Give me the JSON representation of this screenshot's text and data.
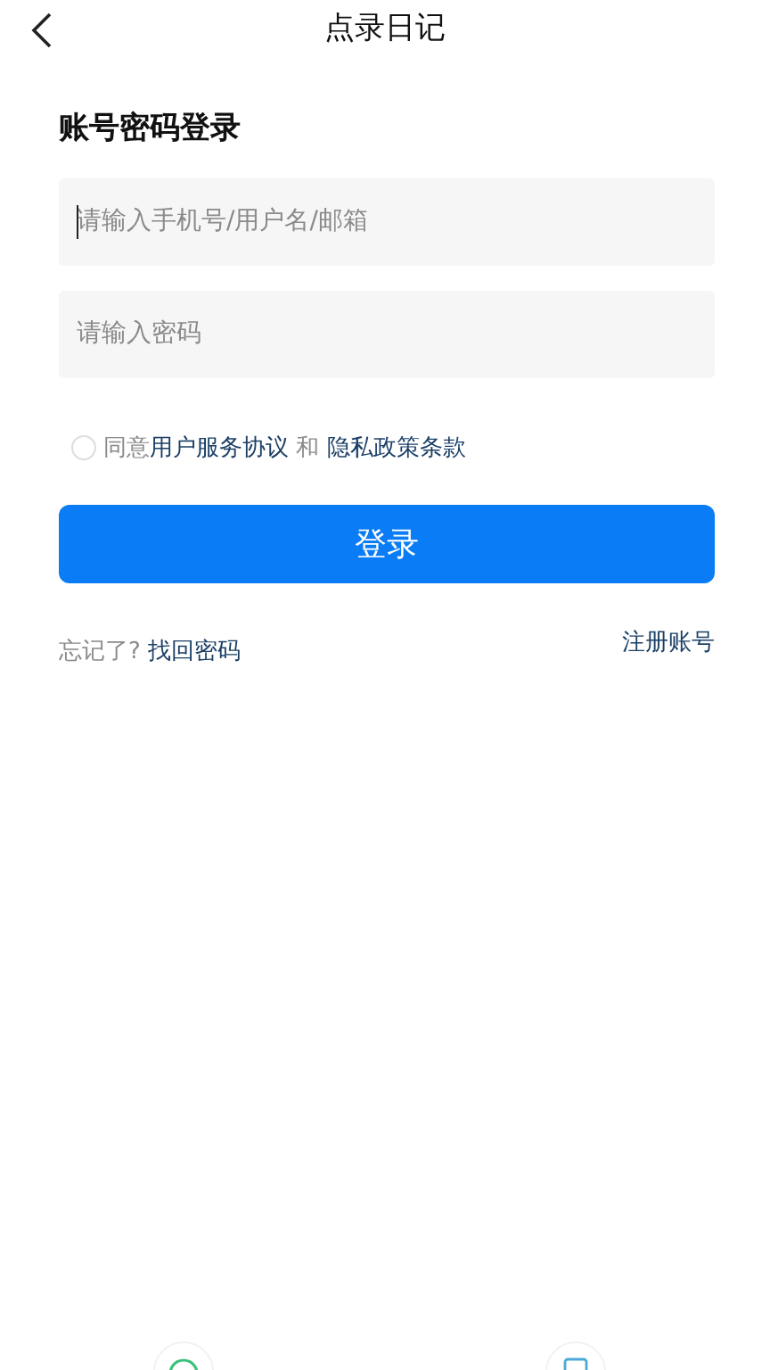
{
  "header": {
    "title": "点录日记"
  },
  "heading": "账号密码登录",
  "fields": [
    {
      "placeholder": "请输入手机号/用户名/邮箱",
      "focused": true
    },
    {
      "placeholder": "请输入密码",
      "focused": false
    }
  ],
  "agreement": {
    "checked": false,
    "prefix": "同意",
    "terms": "用户服务协议",
    "conjunction": " 和 ",
    "privacy": "隐私政策条款"
  },
  "login_button": "登录",
  "forgot": {
    "prompt": "忘记了?",
    "link": "找回密码"
  },
  "register": "注册账号"
}
